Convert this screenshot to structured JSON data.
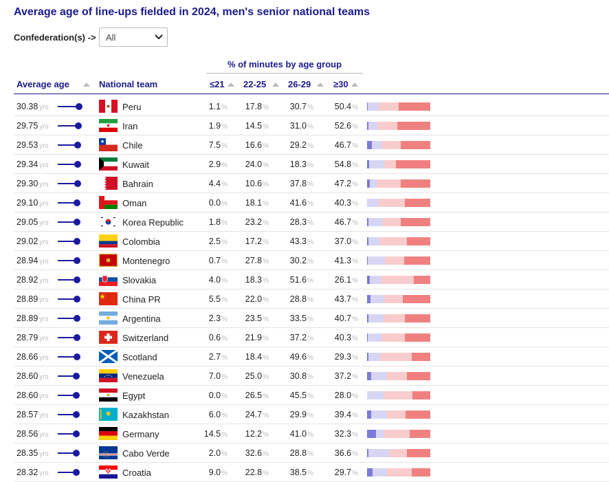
{
  "title": "Average age of line-ups fielded in 2024, men's senior national teams",
  "filter": {
    "label": "Confederation(s) ->",
    "value": "All"
  },
  "group_header": "% of minutes by age group",
  "columns": {
    "avg_age": "Average age",
    "team": "National team",
    "g1": "≤21",
    "g2": "22-25",
    "g3": "26-29",
    "g4": "≥30"
  },
  "units": {
    "yrs": "yrs",
    "pct": "%"
  },
  "colors": {
    "accent": "#1a1a8c",
    "g1": "#7b7bd6",
    "g2": "#d6d6f4",
    "g3": "#f8cccc",
    "g4": "#f08080"
  },
  "rows": [
    {
      "age": "30.38",
      "team": "Peru",
      "flag": "peru",
      "g1": "1.1",
      "g2": "17.8",
      "g3": "30.7",
      "g4": "50.4"
    },
    {
      "age": "29.75",
      "team": "Iran",
      "flag": "iran",
      "g1": "1.9",
      "g2": "14.5",
      "g3": "31.0",
      "g4": "52.6"
    },
    {
      "age": "29.53",
      "team": "Chile",
      "flag": "chile",
      "g1": "7.5",
      "g2": "16.6",
      "g3": "29.2",
      "g4": "46.7"
    },
    {
      "age": "29.34",
      "team": "Kuwait",
      "flag": "kuwait",
      "g1": "2.9",
      "g2": "24.0",
      "g3": "18.3",
      "g4": "54.8"
    },
    {
      "age": "29.30",
      "team": "Bahrain",
      "flag": "bahrain",
      "g1": "4.4",
      "g2": "10.6",
      "g3": "37.8",
      "g4": "47.2"
    },
    {
      "age": "29.10",
      "team": "Oman",
      "flag": "oman",
      "g1": "0.0",
      "g2": "18.1",
      "g3": "41.6",
      "g4": "40.3"
    },
    {
      "age": "29.05",
      "team": "Korea Republic",
      "flag": "korea",
      "g1": "1.8",
      "g2": "23.2",
      "g3": "28.3",
      "g4": "46.7"
    },
    {
      "age": "29.02",
      "team": "Colombia",
      "flag": "colombia",
      "g1": "2.5",
      "g2": "17.2",
      "g3": "43.3",
      "g4": "37.0"
    },
    {
      "age": "28.94",
      "team": "Montenegro",
      "flag": "montenegro",
      "g1": "0.7",
      "g2": "27.8",
      "g3": "30.2",
      "g4": "41.3"
    },
    {
      "age": "28.92",
      "team": "Slovakia",
      "flag": "slovakia",
      "g1": "4.0",
      "g2": "18.3",
      "g3": "51.6",
      "g4": "26.1"
    },
    {
      "age": "28.89",
      "team": "China PR",
      "flag": "china",
      "g1": "5.5",
      "g2": "22.0",
      "g3": "28.8",
      "g4": "43.7"
    },
    {
      "age": "28.89",
      "team": "Argentina",
      "flag": "argentina",
      "g1": "2.3",
      "g2": "23.5",
      "g3": "33.5",
      "g4": "40.7"
    },
    {
      "age": "28.79",
      "team": "Switzerland",
      "flag": "switzerland",
      "g1": "0.6",
      "g2": "21.9",
      "g3": "37.2",
      "g4": "40.3"
    },
    {
      "age": "28.66",
      "team": "Scotland",
      "flag": "scotland",
      "g1": "2.7",
      "g2": "18.4",
      "g3": "49.6",
      "g4": "29.3"
    },
    {
      "age": "28.60",
      "team": "Venezuela",
      "flag": "venezuela",
      "g1": "7.0",
      "g2": "25.0",
      "g3": "30.8",
      "g4": "37.2"
    },
    {
      "age": "28.60",
      "team": "Egypt",
      "flag": "egypt",
      "g1": "0.0",
      "g2": "26.5",
      "g3": "45.5",
      "g4": "28.0"
    },
    {
      "age": "28.57",
      "team": "Kazakhstan",
      "flag": "kazakhstan",
      "g1": "6.0",
      "g2": "24.7",
      "g3": "29.9",
      "g4": "39.4"
    },
    {
      "age": "28.56",
      "team": "Germany",
      "flag": "germany",
      "g1": "14.5",
      "g2": "12.2",
      "g3": "41.0",
      "g4": "32.3"
    },
    {
      "age": "28.35",
      "team": "Cabo Verde",
      "flag": "caboverde",
      "g1": "2.0",
      "g2": "32.6",
      "g3": "28.8",
      "g4": "36.6"
    },
    {
      "age": "28.32",
      "team": "Croatia",
      "flag": "croatia",
      "g1": "9.0",
      "g2": "22.8",
      "g3": "38.5",
      "g4": "29.7"
    }
  ]
}
